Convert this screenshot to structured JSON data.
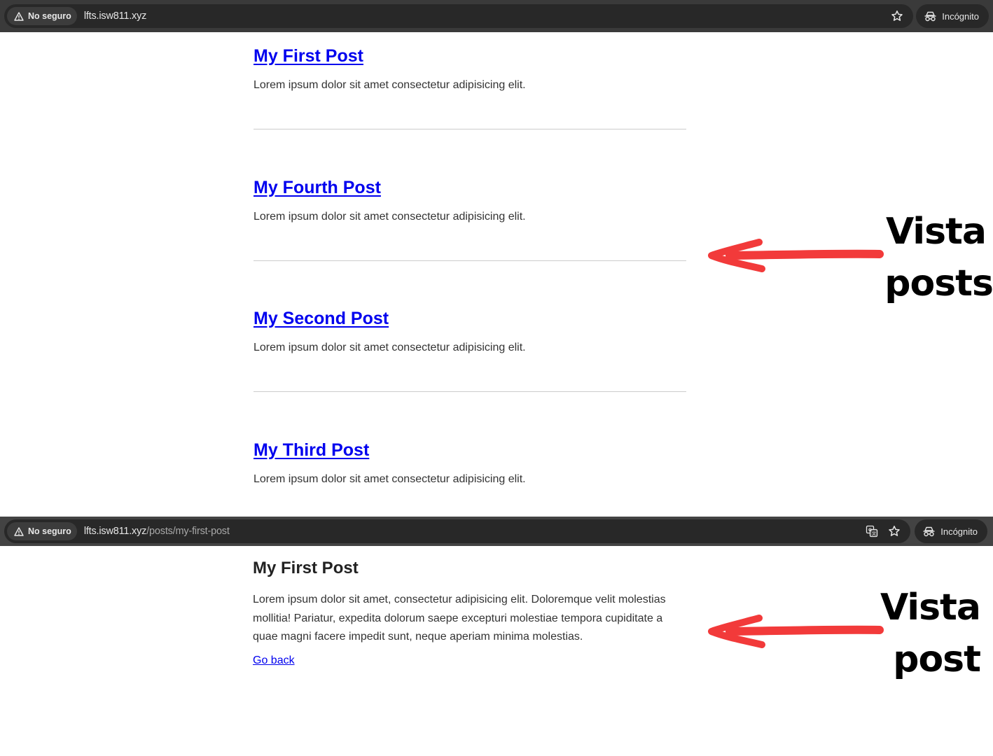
{
  "browser_top": {
    "security_label": "No seguro",
    "url": "lfts.isw811.xyz",
    "profile_label": "Incógnito"
  },
  "posts": [
    {
      "title": "My First Post",
      "excerpt": "Lorem ipsum dolor sit amet consectetur adipisicing elit."
    },
    {
      "title": "My Fourth Post",
      "excerpt": "Lorem ipsum dolor sit amet consectetur adipisicing elit."
    },
    {
      "title": "My Second Post",
      "excerpt": "Lorem ipsum dolor sit amet consectetur adipisicing elit."
    },
    {
      "title": "My Third Post",
      "excerpt": "Lorem ipsum dolor sit amet consectetur adipisicing elit."
    }
  ],
  "browser_bottom": {
    "security_label": "No seguro",
    "url_host": "lfts.isw811.xyz",
    "url_path": "/posts/my-first-post",
    "profile_label": "Incógnito"
  },
  "post_detail": {
    "title": "My First Post",
    "body": "Lorem ipsum dolor sit amet, consectetur adipisicing elit. Doloremque velit molestias mollitia! Pariatur, expedita dolorum saepe excepturi molestiae tempora cupiditate a quae magni facere impedit sunt, neque aperiam minima molestias.",
    "back_link": "Go back"
  },
  "annotations": {
    "posts_view": {
      "line1": "Vista",
      "line2": "posts"
    },
    "post_view": {
      "line1": "Vista",
      "line2": "post"
    },
    "arrow_color": "#f23a3a"
  },
  "colors": {
    "link": "#0000ee",
    "browser_bar": "#3c3c3c",
    "omnibox": "#282828"
  }
}
